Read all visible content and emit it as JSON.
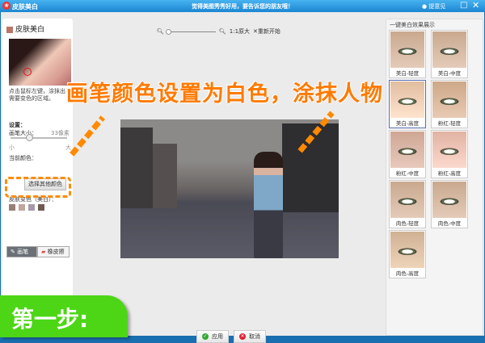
{
  "window": {
    "app_title": "皮肤美白",
    "slogan": "觉得美图秀秀好用，要告诉您的朋友哦！",
    "feedback": "提意见",
    "maximize": "□",
    "close": "✕"
  },
  "left": {
    "title": "皮肤美白",
    "hint": "点击鼠标左键，涂抹出需要变色的区域。",
    "settings_label": "设置：",
    "brush_size_label": "画笔大小：",
    "brush_size_value": "33像素",
    "brush_size_fraction": 0.3,
    "min_label": "小",
    "max_label": "大",
    "current_color_label": "当前颜色：",
    "choose_color": "选择其他颜色",
    "skin_color_label": "皮肤变色（美白）：",
    "swatches": [
      "#9a7f76",
      "#bfa79c",
      "#a59aaa",
      "#6e5b4e"
    ],
    "brush_tool": "画笔",
    "eraser_tool": "橡皮擦"
  },
  "toolbar": {
    "actual_size": "1:1原大",
    "restart": "重新开始"
  },
  "right": {
    "title": "一键美白效果展示",
    "presets": [
      "美白-轻度",
      "美白-中度",
      "美白-高度",
      "粉红-轻度",
      "粉红-中度",
      "粉红-高度",
      "肉色-轻度",
      "肉色-中度",
      "肉色-高度"
    ],
    "selected": "美白-高度"
  },
  "overlay": {
    "instruction": "画笔颜色设置为白色，涂抹人物",
    "step": "第一步:"
  },
  "footer": {
    "apply": "应用",
    "cancel": "取消"
  },
  "colors": {
    "accent": "#ff7a00",
    "step": "#4cd616",
    "titlebar": "#1b86d2"
  }
}
